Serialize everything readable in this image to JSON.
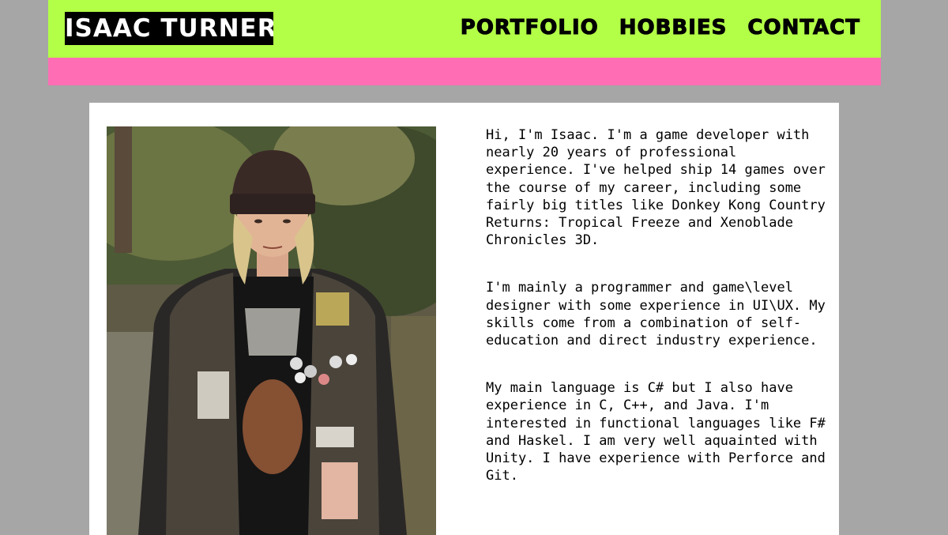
{
  "header": {
    "logo_text": "ISAAC TURNER",
    "nav": [
      {
        "label": "PORTFOLIO"
      },
      {
        "label": "HOBBIES"
      },
      {
        "label": "CONTACT"
      }
    ]
  },
  "colors": {
    "page_bg": "#a6a6a6",
    "header_bg": "#b3ff47",
    "accent_bar": "#ff6eb4",
    "card_bg": "#ffffff"
  },
  "photo": {
    "subject": "portrait-photo"
  },
  "bio": {
    "paragraphs": [
      "Hi, I'm Isaac. I'm a game developer with nearly 20 years of professional experience. I've helped ship 14 games over the course of my career, including some fairly big titles like Donkey Kong Country Returns: Tropical Freeze and Xenoblade Chronicles 3D.",
      "I'm mainly a programmer and game\\level designer with some experience in UI\\UX. My skills come from a combination of self-education and direct industry experience.",
      "My main language is C# but I also have experience in C, C++, and Java. I'm interested in functional languages like F# and Haskel. I am very well aquainted with Unity. I have experience with Perforce and Git."
    ]
  }
}
